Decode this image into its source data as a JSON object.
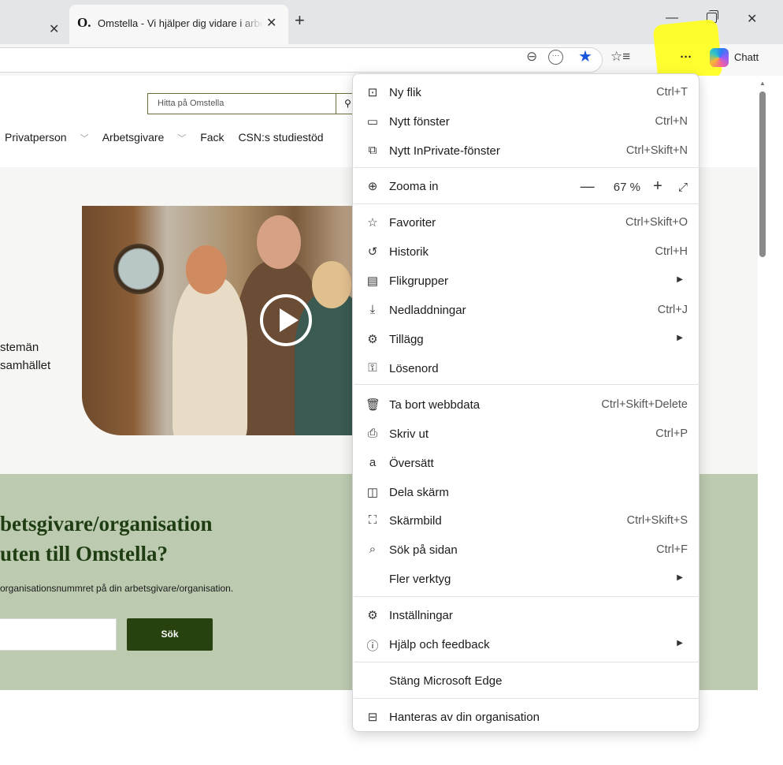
{
  "browser": {
    "tab_title": "Omstella - Vi hjälper dig vidare i arbetslivet",
    "tab_favicon": "O.",
    "chat_label": "Chatt",
    "colors": {
      "highlight": "#ffff19",
      "accent_star": "#1a56db"
    }
  },
  "site": {
    "search_placeholder": "Hitta på Omstella",
    "nav": [
      "Privatperson",
      "Arbetsgivare",
      "Fack",
      "CSN:s studiestöd"
    ],
    "hero_line1": "stemän",
    "hero_line2": "samhället",
    "band_heading1": "betsgivare/organisation",
    "band_heading2": "uten till Omstella?",
    "band_text": "organisationsnummret på din arbetsgivare/organisation.",
    "band_button": "Sök",
    "brand_green": "#27420f"
  },
  "menu": {
    "items": [
      {
        "label": "Ny flik",
        "shortcut": "Ctrl+T",
        "icon": "new-tab-icon"
      },
      {
        "label": "Nytt fönster",
        "shortcut": "Ctrl+N",
        "icon": "window-icon"
      },
      {
        "label": "Nytt InPrivate-fönster",
        "shortcut": "Ctrl+Skift+N",
        "icon": "inprivate-icon"
      },
      {
        "label": "Zooma in",
        "shortcut": "",
        "icon": "zoom-icon"
      },
      {
        "label": "Favoriter",
        "shortcut": "Ctrl+Skift+O",
        "icon": "favorites-icon"
      },
      {
        "label": "Historik",
        "shortcut": "Ctrl+H",
        "icon": "history-icon"
      },
      {
        "label": "Flikgrupper",
        "shortcut": "",
        "icon": "tab-groups-icon"
      },
      {
        "label": "Nedladdningar",
        "shortcut": "Ctrl+J",
        "icon": "download-icon"
      },
      {
        "label": "Tillägg",
        "shortcut": "",
        "icon": "extensions-icon"
      },
      {
        "label": "Lösenord",
        "shortcut": "",
        "icon": "key-icon"
      },
      {
        "label": "Ta bort webbdata",
        "shortcut": "Ctrl+Skift+Delete",
        "icon": "trash-icon"
      },
      {
        "label": "Skriv ut",
        "shortcut": "Ctrl+P",
        "icon": "print-icon"
      },
      {
        "label": "Översätt",
        "shortcut": "",
        "icon": "translate-icon"
      },
      {
        "label": "Dela skärm",
        "shortcut": "",
        "icon": "split-screen-icon"
      },
      {
        "label": "Skärmbild",
        "shortcut": "Ctrl+Skift+S",
        "icon": "screenshot-icon"
      },
      {
        "label": "Sök på sidan",
        "shortcut": "Ctrl+F",
        "icon": "find-icon"
      },
      {
        "label": "Fler verktyg",
        "shortcut": "",
        "icon": ""
      },
      {
        "label": "Inställningar",
        "shortcut": "",
        "icon": "settings-icon"
      },
      {
        "label": "Hjälp och feedback",
        "shortcut": "",
        "icon": "help-icon"
      },
      {
        "label": "Stäng Microsoft Edge",
        "shortcut": "",
        "icon": ""
      },
      {
        "label": "Hanteras av din organisation",
        "shortcut": "",
        "icon": "briefcase-icon"
      }
    ],
    "zoom": {
      "minus": "—",
      "value": "67 %",
      "plus": "+",
      "fullscreen": "⤢"
    }
  }
}
